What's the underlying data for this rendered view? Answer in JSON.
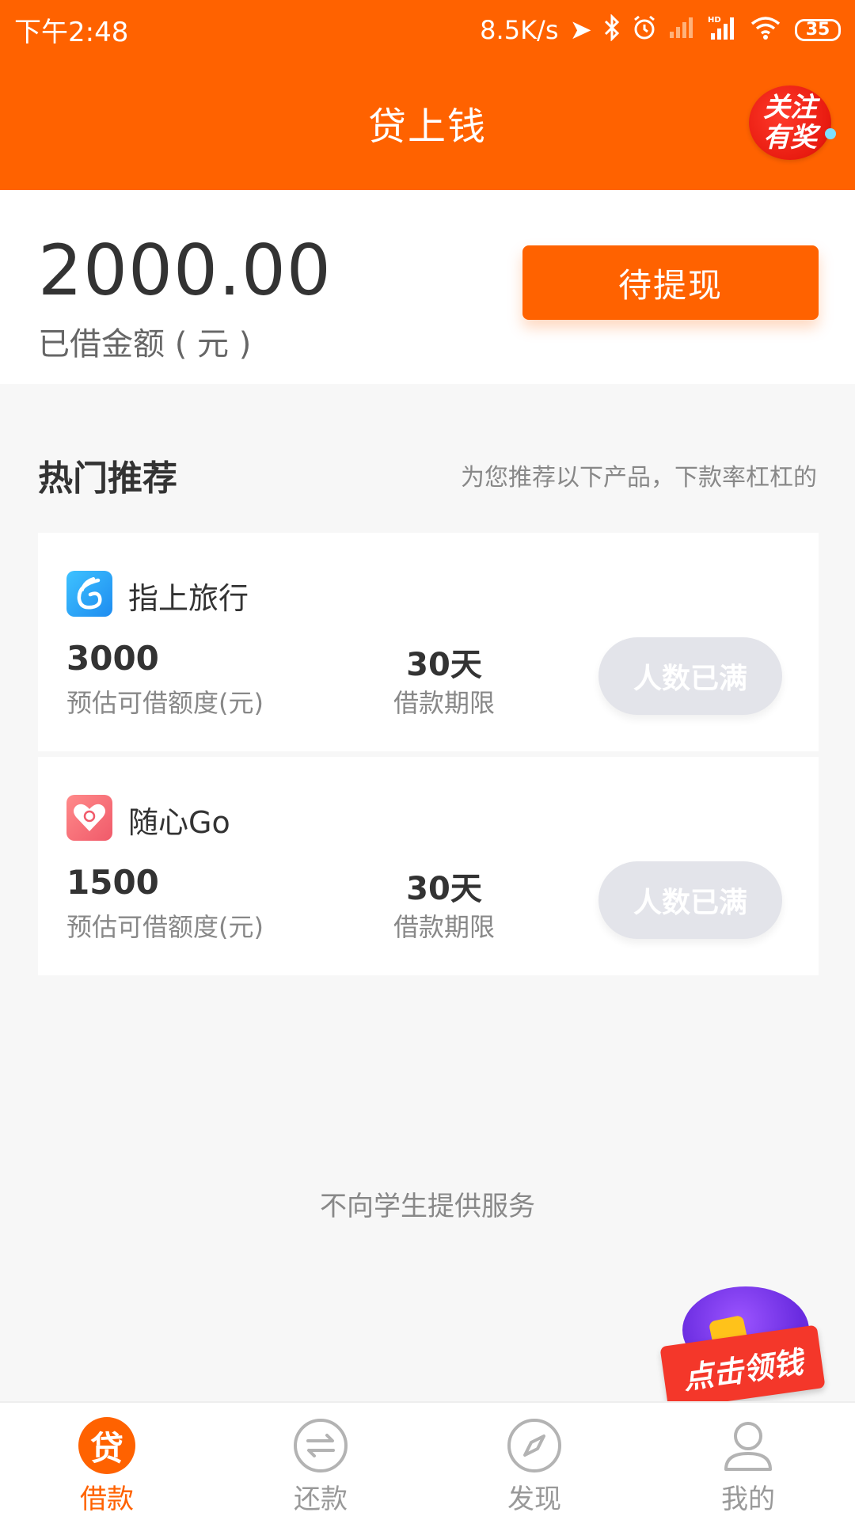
{
  "status_bar": {
    "time": "下午2:48",
    "network_speed": "8.5K/s",
    "battery": "35"
  },
  "header": {
    "title": "贷上钱",
    "follow_badge_line1": "关注",
    "follow_badge_line2": "有奖"
  },
  "summary": {
    "amount": "2000.00",
    "amount_label": "已借金额 ( 元 )",
    "withdraw_button": "待提现"
  },
  "recommend": {
    "title": "热门推荐",
    "subtitle": "为您推荐以下产品，下款率杠杠的",
    "products": [
      {
        "name": "指上旅行",
        "limit": "3000",
        "limit_label": "预估可借额度(元)",
        "term": "30天",
        "term_label": "借款期限",
        "button": "人数已满"
      },
      {
        "name": "随心Go",
        "limit": "1500",
        "limit_label": "预估可借额度(元)",
        "term": "30天",
        "term_label": "借款期限",
        "button": "人数已满"
      }
    ]
  },
  "footnote": "不向学生提供服务",
  "promo": {
    "label": "点击领钱"
  },
  "bottom_nav": {
    "items": [
      {
        "label": "借款",
        "icon_text": "贷",
        "icon": "loan-icon"
      },
      {
        "label": "还款",
        "icon": "repay-icon"
      },
      {
        "label": "发现",
        "icon": "compass-icon"
      },
      {
        "label": "我的",
        "icon": "user-icon"
      }
    ],
    "active_index": 0
  },
  "colors": {
    "brand": "#ff6200",
    "disabled_button": "#e3e4ea"
  }
}
